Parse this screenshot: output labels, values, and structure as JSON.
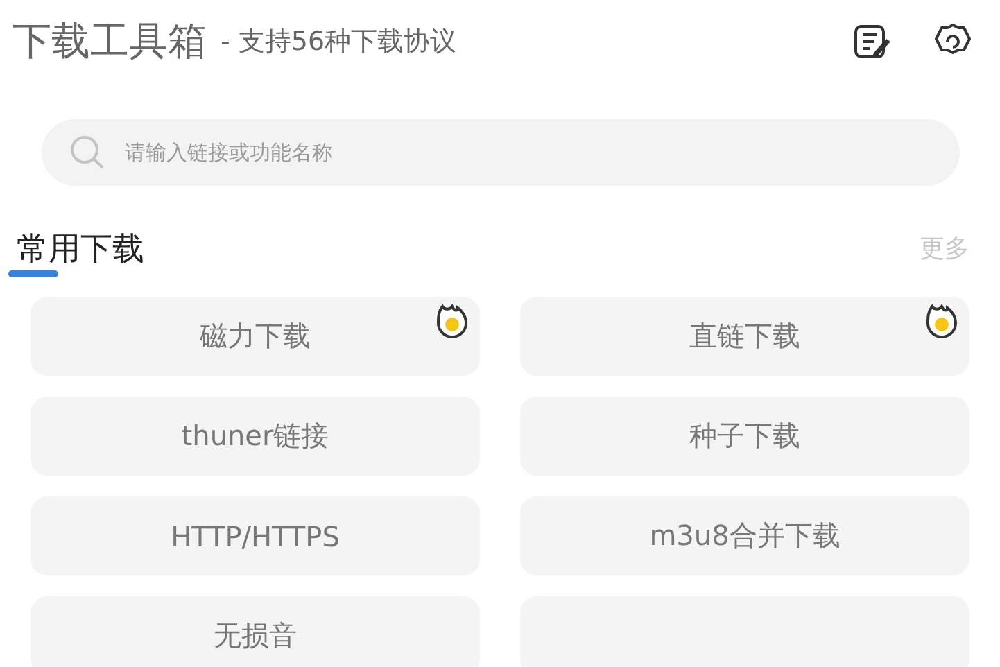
{
  "header": {
    "title": "下载工具箱",
    "subtitle": "- 支持56种下载协议"
  },
  "search": {
    "placeholder": "请输入链接或功能名称"
  },
  "section": {
    "title": "常用下载",
    "more": "更多"
  },
  "tools": [
    {
      "label": "磁力下载",
      "hot": true
    },
    {
      "label": "直链下载",
      "hot": true
    },
    {
      "label": "thuner链接",
      "hot": false
    },
    {
      "label": "种子下载",
      "hot": false
    },
    {
      "label": "HTTP/HTTPS",
      "hot": false
    },
    {
      "label": "m3u8合并下载",
      "hot": false
    },
    {
      "label": "无损音",
      "hot": false
    },
    {
      "hot": false
    }
  ]
}
